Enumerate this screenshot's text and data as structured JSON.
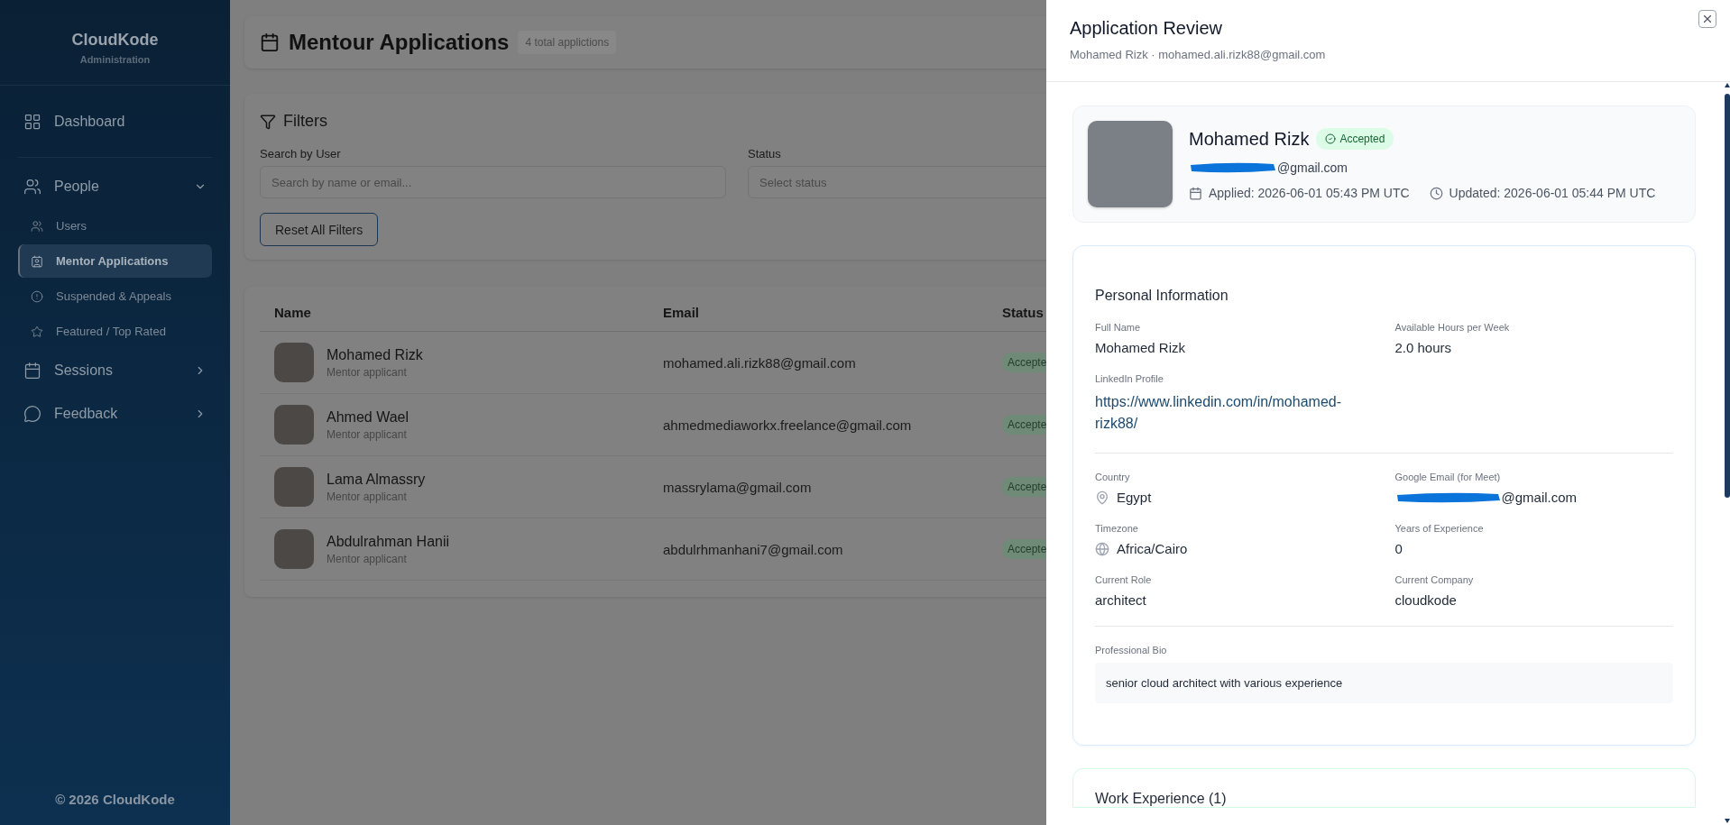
{
  "sidebar": {
    "brand": "CloudKode",
    "subtitle": "Administration",
    "items": [
      {
        "label": "Dashboard",
        "kind": "link"
      },
      {
        "label": "People",
        "kind": "group",
        "expanded": true,
        "children": [
          {
            "label": "Users",
            "selected": false
          },
          {
            "label": "Mentor Applications",
            "selected": true
          },
          {
            "label": "Suspended & Appeals",
            "selected": false
          },
          {
            "label": "Featured / Top Rated",
            "selected": false
          }
        ]
      },
      {
        "label": "Sessions",
        "kind": "group",
        "expanded": false
      },
      {
        "label": "Feedback",
        "kind": "group",
        "expanded": false
      }
    ],
    "footer": "© 2026 CloudKode"
  },
  "page": {
    "title": "Mentour Applications",
    "count": "4 total applictions"
  },
  "filters": {
    "title": "Filters",
    "search_label": "Search by User",
    "search_placeholder": "Search by name or email...",
    "status_label": "Status",
    "status_placeholder": "Select status",
    "reset": "Reset All Filters"
  },
  "table": {
    "columns": [
      "Name",
      "Email",
      "Status"
    ],
    "rows": [
      {
        "name": "Mohamed Rizk",
        "subtitle": "Mentor applicant",
        "email": "mohamed.ali.rizk88@gmail.com",
        "status": "Accepte"
      },
      {
        "name": "Ahmed Wael",
        "subtitle": "Mentor applicant",
        "email": "ahmedmediaworkx.freelance@gmail.com",
        "status": "Accepte"
      },
      {
        "name": "Lama Almassry",
        "subtitle": "Mentor applicant",
        "email": "massrylama@gmail.com",
        "status": "Accepte"
      },
      {
        "name": "Abdulrahman Hanii",
        "subtitle": "Mentor applicant",
        "email": "abdulrhmanhani7@gmail.com",
        "status": "Accepte"
      }
    ]
  },
  "drawer": {
    "title": "Application Review",
    "subtitle": "Mohamed Rizk · mohamed.ali.rizk88@gmail.com",
    "profile": {
      "name": "Mohamed Rizk",
      "status": "Accepted",
      "email": "@gmail.com",
      "applied": "Applied: 2026-06-01 05:43 PM UTC",
      "updated": "Updated: 2026-06-01 05:44 PM UTC"
    },
    "personal": {
      "title": "Personal Information",
      "sections": [
        {
          "fields": [
            {
              "label": "Full Name",
              "value": "Mohamed Rizk",
              "kind": "text"
            },
            {
              "label": "Available Hours per Week",
              "value": "2.0 hours",
              "kind": "text"
            },
            {
              "label": "LinkedIn Profile",
              "value": "https://www.linkedin.com/in/mohamed-rizk88/",
              "kind": "link"
            }
          ]
        },
        {
          "fields": [
            {
              "label": "Country",
              "value": "Egypt",
              "kind": "location"
            },
            {
              "label": "Google Email (for Meet)",
              "value": "@gmail.com",
              "kind": "redacted"
            },
            {
              "label": "Timezone",
              "value": "Africa/Cairo",
              "kind": "timezone"
            },
            {
              "label": "Years of Experience",
              "value": "0",
              "kind": "text"
            },
            {
              "label": "Current Role",
              "value": "architect",
              "kind": "text"
            },
            {
              "label": "Current Company",
              "value": "cloudkode",
              "kind": "text"
            }
          ]
        }
      ],
      "bio_label": "Professional Bio",
      "bio": "senior cloud architect with various experience"
    },
    "work_title": "Work Experience (1)"
  }
}
